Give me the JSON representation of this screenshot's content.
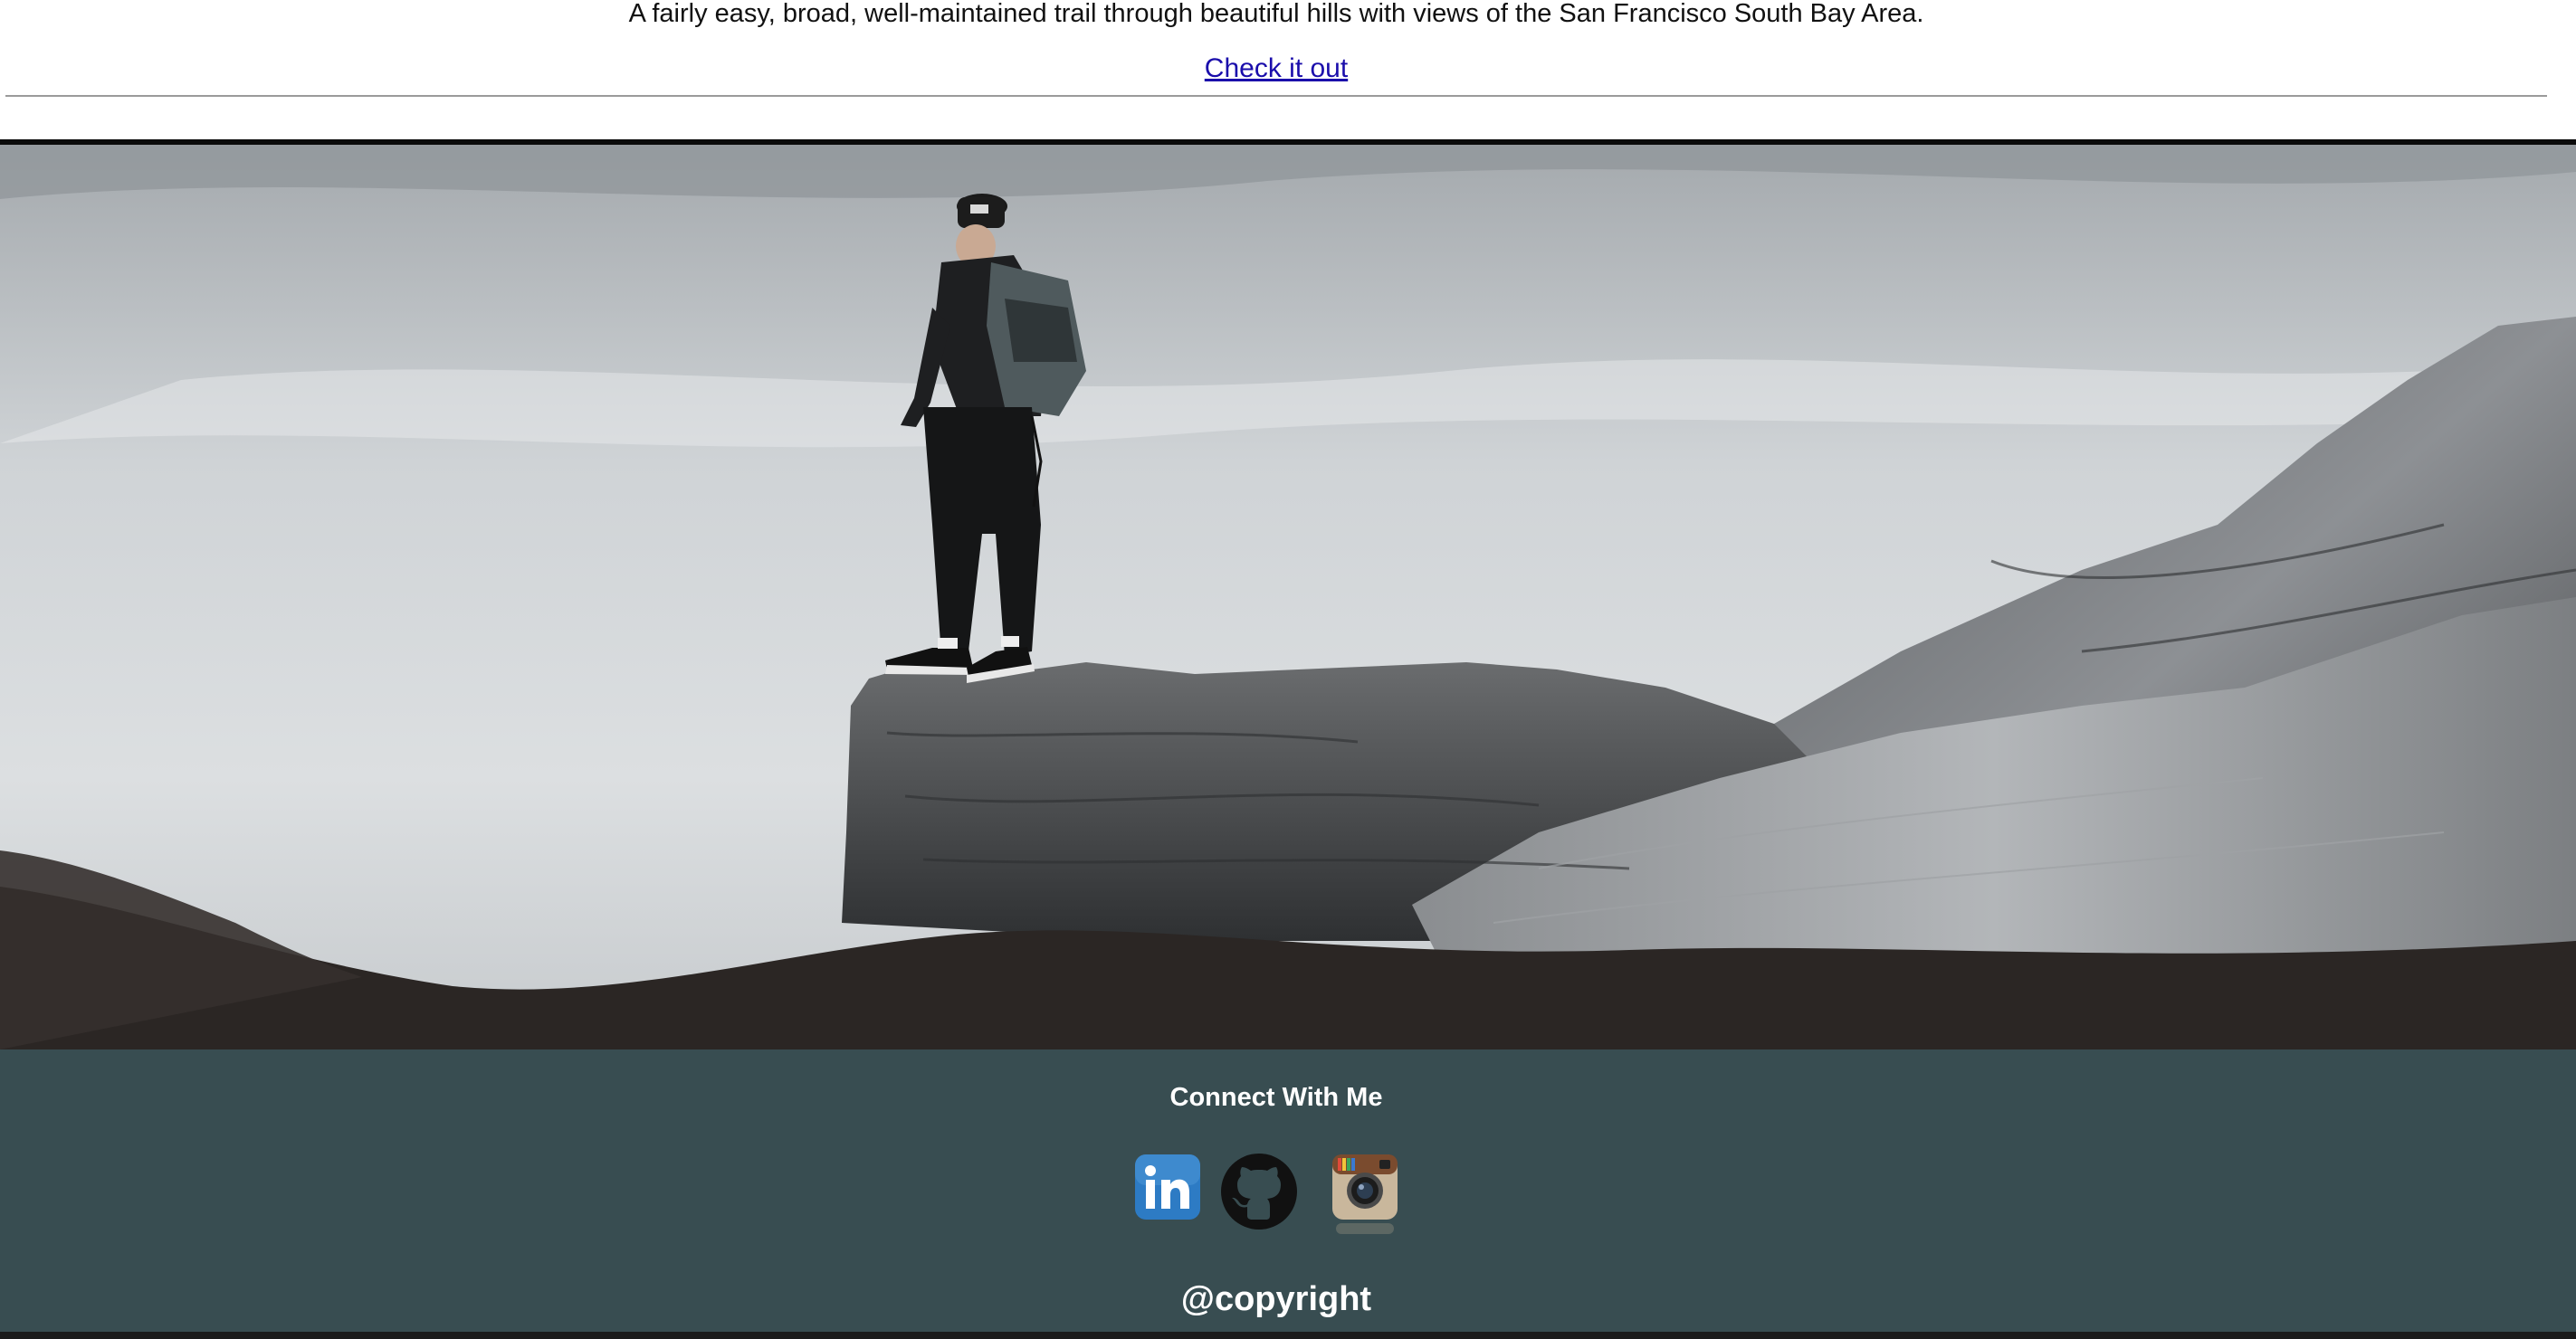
{
  "trail": {
    "description": "A fairly easy, broad, well-maintained trail through beautiful hills with views of the San Francisco South Bay Area.",
    "link_label": "Check it out"
  },
  "footer": {
    "heading": "Connect With Me",
    "social": [
      {
        "icon": "linkedin-icon",
        "label": "in",
        "color": "#2d7bc4"
      },
      {
        "icon": "github-icon",
        "color": "#111111"
      },
      {
        "icon": "instagram-icon",
        "color": "#c9b79c"
      }
    ],
    "copyright": "@copyright",
    "background": "#384d51"
  }
}
